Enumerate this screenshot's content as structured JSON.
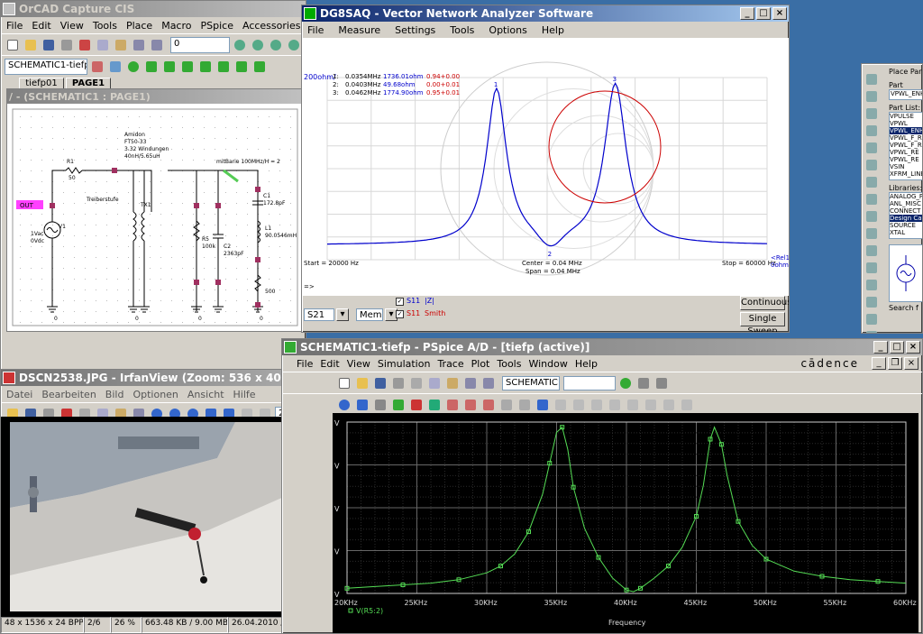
{
  "orcad": {
    "title": "OrCAD Capture CIS",
    "menu": [
      "File",
      "Edit",
      "View",
      "Tools",
      "Place",
      "Macro",
      "PSpice",
      "Accessories",
      "Options"
    ],
    "part_combo": "0",
    "project_combo": "SCHEMATIC1-tiefp",
    "tabs": [
      "tiefp01",
      "PAGE1"
    ],
    "schem_title": "/ - (SCHEMATIC1 : PAGE1)",
    "schematic": {
      "note_lines": [
        "Amidon",
        "FT50-33",
        "3.32 Windungen",
        "40nH/5.65uH"
      ],
      "r1": "R1",
      "r1v": "50",
      "v1": "1Vac\n0Vdc",
      "v1_label": "V1",
      "tx1": "TX1",
      "treiber": "Treiberstufe",
      "r5": "R5",
      "r5v": "100k",
      "c2": "C2",
      "c2v": "2363pF",
      "c1": "C1",
      "c1v": "172.8pF",
      "l1": "L1",
      "l1v": "90.0546mH",
      "r500": "500",
      "verfahren": "mitBarie 100MHz/H = 2",
      "out_label": "OUT",
      "zero": "0"
    }
  },
  "vna": {
    "title": "DG8SAQ  -  Vector Network Analyzer Software",
    "menu": [
      "File",
      "Measure",
      "Settings",
      "Tools",
      "Options",
      "Help"
    ],
    "scale_label": "200ohm/",
    "markers": [
      {
        "n": "1:",
        "freq": "0.0354MHz",
        "mag": "1736.01ohm",
        "smith": "0.94+0.00"
      },
      {
        "n": "2:",
        "freq": "0.0403MHz",
        "mag": "49.68ohm",
        "smith": "0.00+0.01"
      },
      {
        "n": "3:",
        "freq": "0.0462MHz",
        "mag": "1774.90ohm",
        "smith": "0.95+0.01"
      }
    ],
    "start": "Start = 20000 Hz",
    "center": "Center = 0.04 MHz",
    "span": "Span = 0.04 MHz",
    "stop": "Stop = 60000 Hz",
    "rel_label": "<Rel1\n0ohm",
    "arrow": "=>",
    "s21_combo": "S21",
    "mem_combo": "Mem 1",
    "trace1_a": "S11",
    "trace1_b": "|Z|",
    "trace2_a": "S11",
    "trace2_b": "Smith",
    "btn_cont": "Continuous",
    "btn_single": "Single Sweep",
    "colors": {
      "blue": "#0000cc",
      "red": "#cc0000",
      "grid": "#d8d8d8"
    }
  },
  "placepart": {
    "title": "Place Part",
    "part_label": "Part",
    "part_value": "VPWL_ENH",
    "list_label": "Part List:",
    "parts": [
      "VPULSE",
      "VPWL",
      "VPWL_ENH",
      "VPWL_F_R",
      "VPWL_F_R",
      "VPWL_RE",
      "VPWL_RE",
      "VSIN",
      "XFRM_LINE"
    ],
    "lib_label": "Libraries:",
    "libs": [
      "ANALOG_P",
      "ANL_MISC",
      "CONNECT",
      "Design Ca",
      "SOURCE",
      "XTAL"
    ],
    "search": "Search f"
  },
  "irfan": {
    "title": "DSCN2538.JPG - IrfanView (Zoom: 536 x 402)",
    "menu": [
      "Datei",
      "Bearbeiten",
      "Bild",
      "Optionen",
      "Ansicht",
      "Hilfe"
    ],
    "page": "2/6",
    "status": [
      "48 x 1536 x 24 BPP",
      "2/6",
      "26 %",
      "663.48 KB / 9.00 MB",
      "26.04.2010 / 17:17:24"
    ]
  },
  "pspice": {
    "title": "SCHEMATIC1-tiefp - PSpice A/D  - [tiefp (active)]",
    "menu": [
      "File",
      "Edit",
      "View",
      "Simulation",
      "Trace",
      "Plot",
      "Tools",
      "Window",
      "Help"
    ],
    "brand": "cādence",
    "sim_combo": "SCHEMATIC1-tiefp",
    "chart_data": {
      "type": "line",
      "x_tick_labels": [
        "20KHz",
        "25KHz",
        "30KHz",
        "35KHz",
        "40KHz",
        "45KHz",
        "50KHz",
        "55KHz",
        "60KHz"
      ],
      "xlabel": "Frequency",
      "y_tick_labels": [
        "V",
        "V",
        "V",
        "V",
        "V"
      ],
      "xlim": [
        20,
        60
      ],
      "ylim": [
        0,
        1
      ],
      "grid": true,
      "background": "#000000",
      "line_color": "#55dd55",
      "series": [
        {
          "name": "V(R5:2)",
          "x": [
            20,
            22,
            24,
            26,
            28,
            30,
            31,
            32,
            33,
            34,
            34.5,
            35,
            35.4,
            35.8,
            36.2,
            37,
            38,
            39,
            40,
            40.5,
            41,
            42,
            43,
            44,
            45,
            45.5,
            46,
            46.3,
            46.8,
            47.2,
            48,
            49,
            50,
            52,
            54,
            56,
            58,
            60
          ],
          "y": [
            0.03,
            0.04,
            0.05,
            0.06,
            0.08,
            0.12,
            0.16,
            0.23,
            0.36,
            0.58,
            0.76,
            0.94,
            0.97,
            0.84,
            0.62,
            0.38,
            0.21,
            0.09,
            0.02,
            0.01,
            0.03,
            0.09,
            0.16,
            0.27,
            0.45,
            0.63,
            0.9,
            0.97,
            0.87,
            0.69,
            0.42,
            0.28,
            0.2,
            0.13,
            0.1,
            0.08,
            0.07,
            0.06
          ]
        }
      ]
    }
  }
}
